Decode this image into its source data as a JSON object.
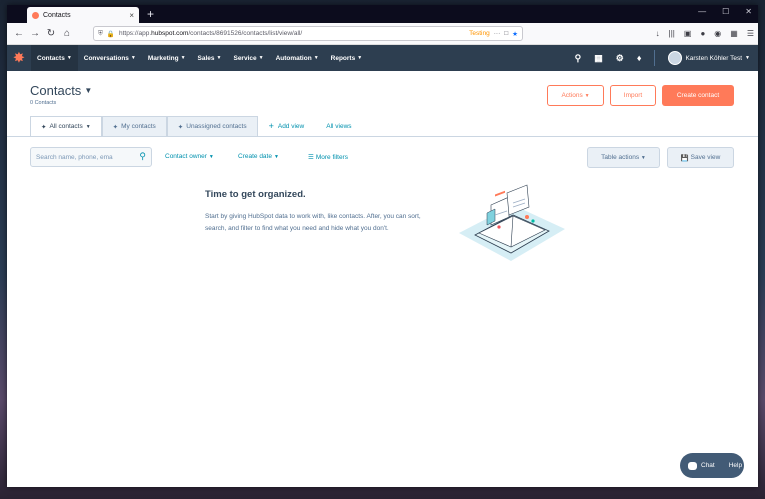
{
  "browser": {
    "tab_title": "Contacts",
    "tab_close": "×",
    "new_tab": "+",
    "window_controls": [
      "—",
      "☐",
      "✕"
    ],
    "url_prefix": "https://app.",
    "url_host": "hubspot.com",
    "url_path": "/contacts/8691526/contacts/list/view/all/",
    "testing_label": "Testing"
  },
  "hubspot_nav": {
    "items": [
      "Contacts",
      "Conversations",
      "Marketing",
      "Sales",
      "Service",
      "Automation",
      "Reports"
    ],
    "user_name": "Karsten Köhler Test"
  },
  "page": {
    "title": "Contacts",
    "count": "0 Contacts",
    "actions_label": "Actions",
    "import_label": "Import",
    "create_label": "Create contact"
  },
  "views": {
    "tabs": [
      "All contacts",
      "My contacts",
      "Unassigned contacts"
    ],
    "add_view": "Add view",
    "all_views": "All views"
  },
  "filters": {
    "search_placeholder": "Search name, phone, ema",
    "contact_owner": "Contact owner",
    "create_date": "Create date",
    "more_filters": "More filters",
    "table_actions": "Table actions",
    "save_view": "Save view"
  },
  "empty_state": {
    "heading": "Time to get organized.",
    "body": "Start by giving HubSpot data to work with, like contacts. After, you can sort, search, and filter to find what you need and hide what you don't."
  },
  "chat": {
    "chat_label": "Chat",
    "help_label": "Help"
  },
  "colors": {
    "accent": "#ff7a59",
    "nav_bg": "#2d3e50",
    "link": "#0091ae",
    "text": "#33475b"
  }
}
